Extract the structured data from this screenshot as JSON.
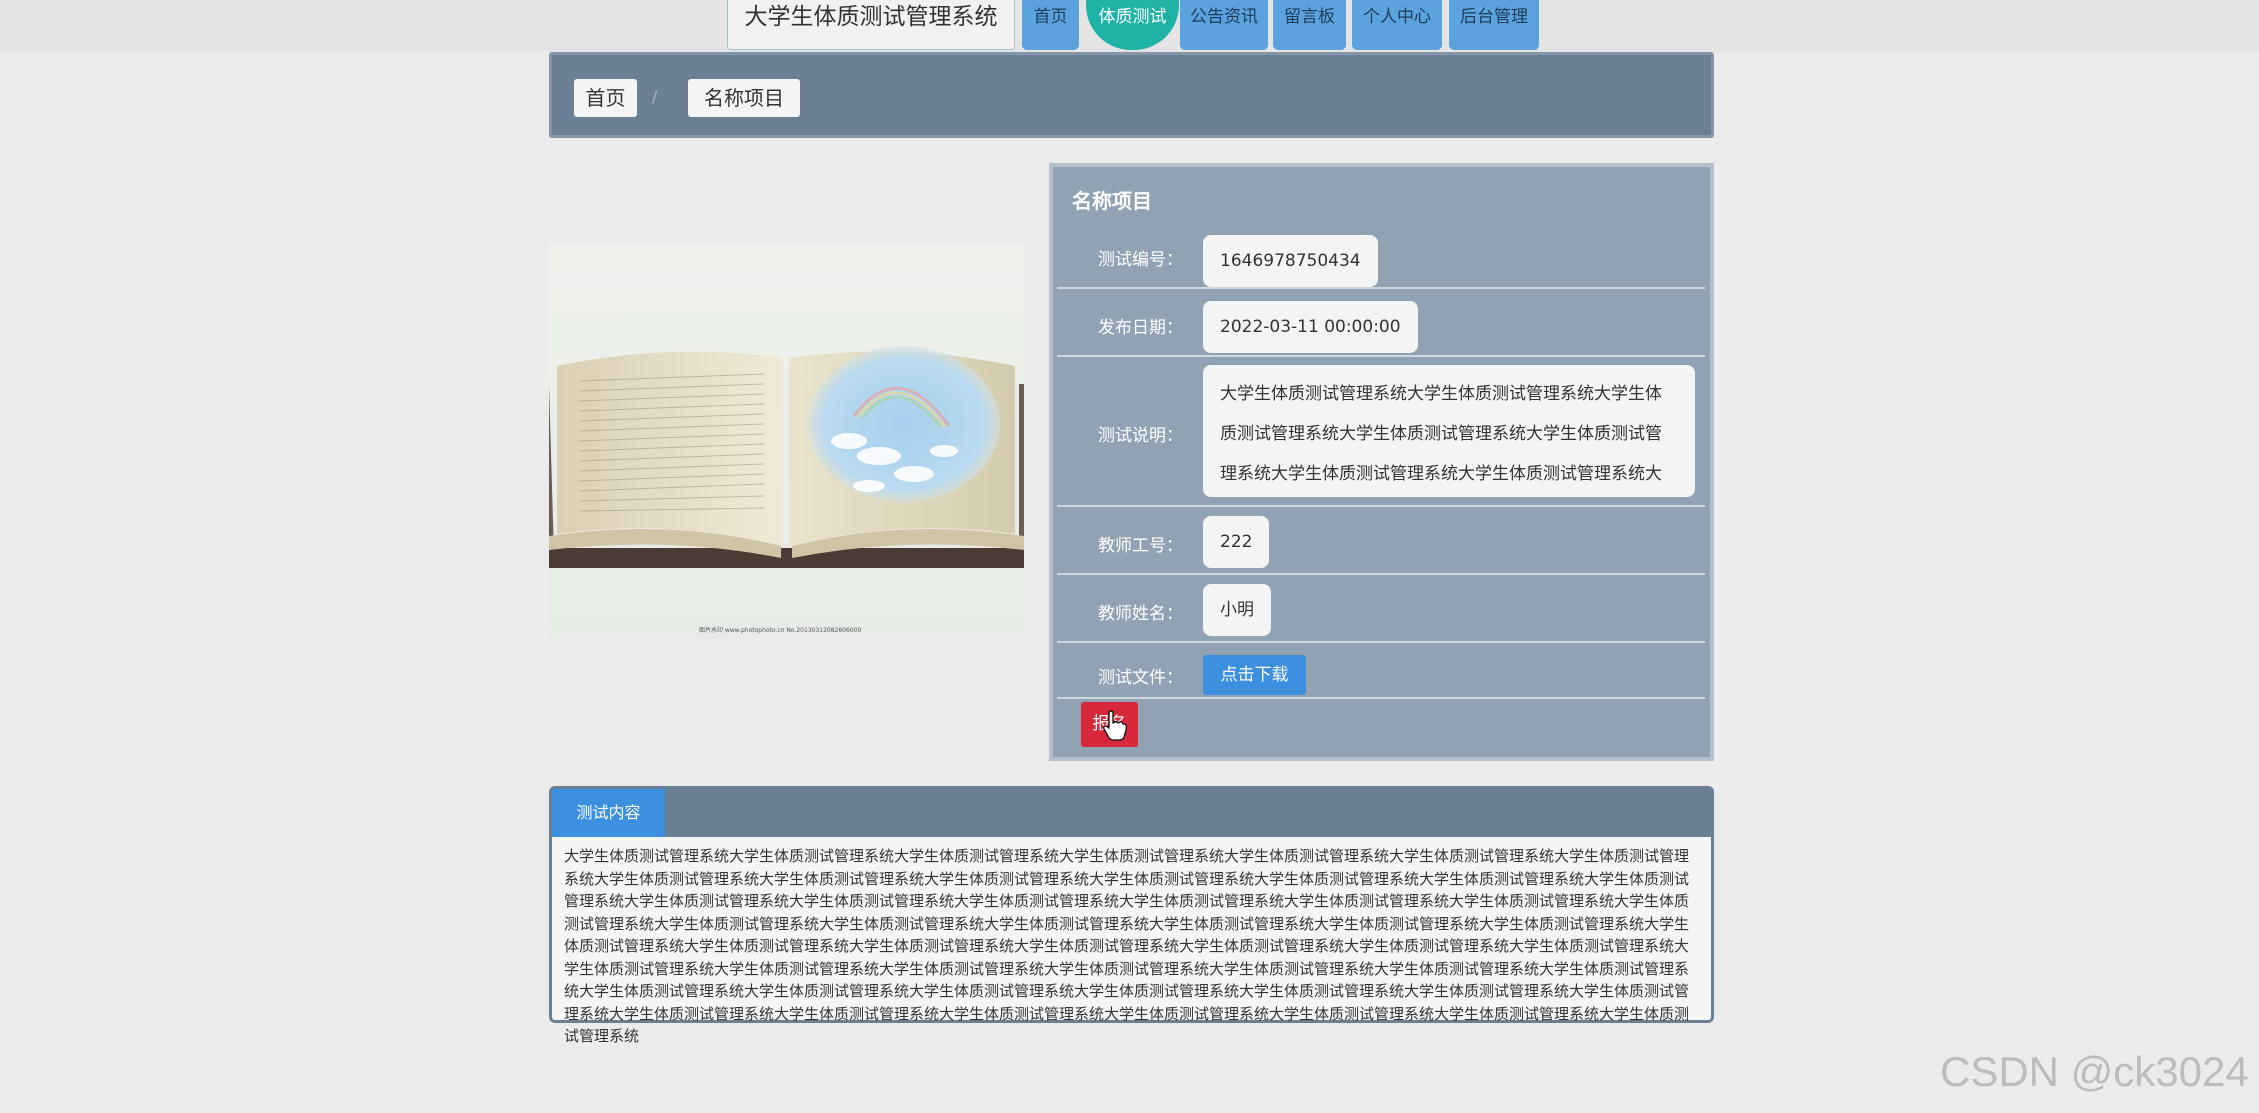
{
  "site_title": "大学生体质测试管理系统",
  "nav": [
    {
      "label": "首页"
    },
    {
      "label": "体质测试"
    },
    {
      "label": "公告资讯"
    },
    {
      "label": "留言板"
    },
    {
      "label": "个人中心"
    },
    {
      "label": "后台管理"
    }
  ],
  "breadcrumb": {
    "home": "首页",
    "separator": "/",
    "current": "名称项目"
  },
  "detail": {
    "title": "名称项目",
    "rows": [
      {
        "label": "测试编号：",
        "value": "1646978750434"
      },
      {
        "label": "发布日期：",
        "value": "2022-03-11 00:00:00"
      },
      {
        "label": "测试说明：",
        "value": "大学生体质测试管理系统大学生体质测试管理系统大学生体质测试管理系统大学生体质测试管理系统大学生体质测试管理系统大学生体质测试管理系统大学生体质测试管理系统大学生"
      },
      {
        "label": "教师工号：",
        "value": "222"
      },
      {
        "label": "教师姓名：",
        "value": "小明"
      },
      {
        "label": "测试文件：",
        "button": "点击下载"
      }
    ],
    "report_button": "报名"
  },
  "content": {
    "tab_label": "测试内容",
    "text": "大学生体质测试管理系统大学生体质测试管理系统大学生体质测试管理系统大学生体质测试管理系统大学生体质测试管理系统大学生体质测试管理系统大学生体质测试管理系统大学生体质测试管理系统大学生体质测试管理系统大学生体质测试管理系统大学生体质测试管理系统大学生体质测试管理系统大学生体质测试管理系统大学生体质测试管理系统大学生体质测试管理系统大学生体质测试管理系统大学生体质测试管理系统大学生体质测试管理系统大学生体质测试管理系统大学生体质测试管理系统大学生体质测试管理系统大学生体质测试管理系统大学生体质测试管理系统大学生体质测试管理系统大学生体质测试管理系统大学生体质测试管理系统大学生体质测试管理系统大学生体质测试管理系统大学生体质测试管理系统大学生体质测试管理系统大学生体质测试管理系统大学生体质测试管理系统大学生体质测试管理系统大学生体质测试管理系统大学生体质测试管理系统大学生体质测试管理系统大学生体质测试管理系统大学生体质测试管理系统大学生体质测试管理系统大学生体质测试管理系统大学生体质测试管理系统大学生体质测试管理系统大学生体质测试管理系统大学生体质测试管理系统大学生体质测试管理系统大学生体质测试管理系统大学生体质测试管理系统大学生体质测试管理系统大学生体质测试管理系统大学生体质测试管理系统大学生体质测试管理系统大学生体质测试管理系统大学生体质测试管理系统大学生体质测试管理系统大学生体质测试管理系统"
  },
  "watermark": "CSDN @ck3024",
  "colors": {
    "nav_button": "#5aa3df",
    "nav_active": "#1fb3a8",
    "panel": "#91a2b4",
    "bar": "#6b7f95",
    "download": "#3d8fe0",
    "report": "#d8283b"
  },
  "icons": {
    "cursor": "hand-pointer-icon"
  }
}
